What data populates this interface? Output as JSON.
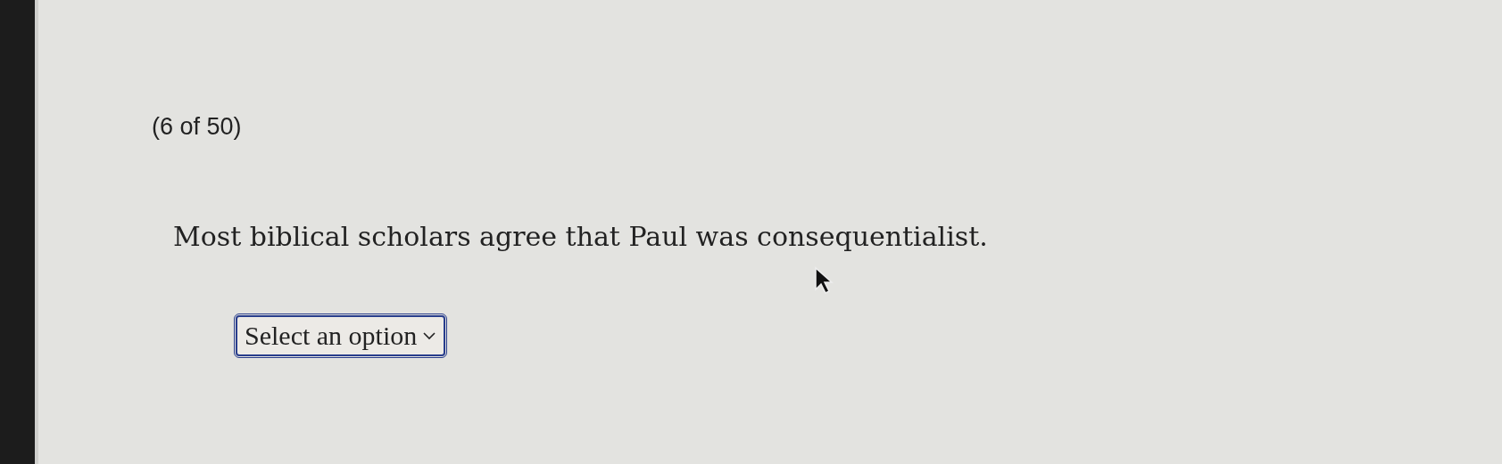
{
  "counter": "(6 of 50)",
  "question": "Most biblical scholars agree that Paul was consequentialist.",
  "answer_select": {
    "value": "Select an option"
  }
}
